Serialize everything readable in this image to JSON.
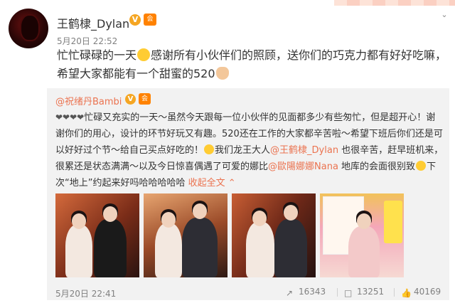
{
  "post": {
    "username": "王鹤棣_Dylan",
    "verified_badge": "V",
    "member_icon": "会",
    "time": "5月20日 22:52",
    "text_1": "忙忙碌碌的一天",
    "text_2": "感谢所有小伙伴们的照顾，送你们的巧克力都有好好吃嘛，希望大家都能有一个甜蜜的520"
  },
  "repost": {
    "username": "@祝绪丹Bambi",
    "verified_badge": "V",
    "member_icon": "会",
    "seg_1": "忙碌又充实的一天～虽然今天跟每一位小伙伴的见面都多少有些匆忙，但是超开心！谢谢你们的用心，设计的环节好玩又有趣。520还在工作的大家都辛苦啦～希望下班后你们还是可以好好过个节～给自己买点好吃的！",
    "seg_2": "我们龙王大人",
    "mention_1": "@王鹤棣_Dylan",
    "seg_3": " 也很辛苦，赶早班机来，很累还是状态满满～以及今日惊喜偶遇了可爱的娜比",
    "mention_2": "@歐陽娜娜Nana",
    "seg_4": " 地库的会面很别致",
    "seg_5": "下次“地上”约起来好吗哈哈哈哈哈 ",
    "expand_label": "收起全文",
    "expand_arrow": "⌃",
    "time": "5月20日 22:41",
    "shares": "16343",
    "comments": "13251",
    "likes": "40169"
  },
  "icons": {
    "share": "share-icon",
    "comment": "comment-icon",
    "like": "like-icon"
  }
}
